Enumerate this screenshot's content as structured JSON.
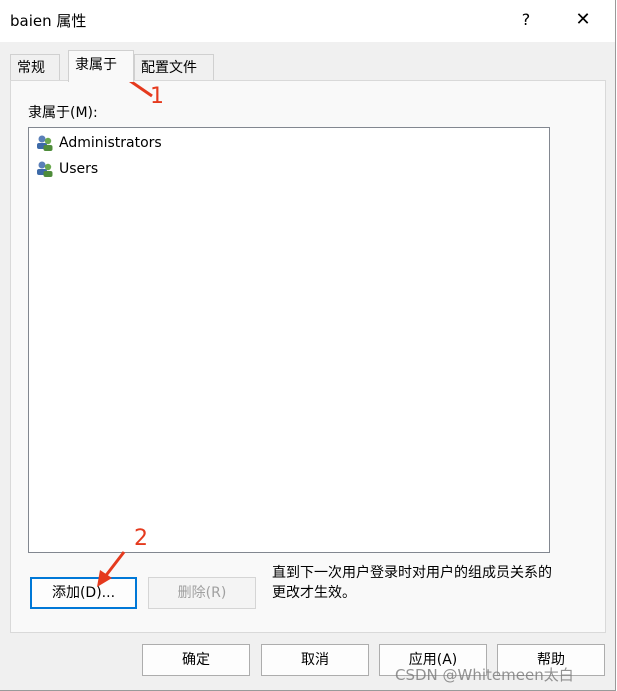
{
  "window": {
    "title": "baien 属性",
    "help_label": "?",
    "close_label": "✕"
  },
  "tabs": [
    {
      "label": "常规",
      "active": false
    },
    {
      "label": "隶属于",
      "active": true
    },
    {
      "label": "配置文件",
      "active": false
    }
  ],
  "member_of": {
    "label": "隶属于(M):",
    "items": [
      "Administrators",
      "Users"
    ]
  },
  "buttons": {
    "add": "添加(D)...",
    "remove": "删除(R)",
    "ok": "确定",
    "cancel": "取消",
    "apply": "应用(A)",
    "help": "帮助"
  },
  "note": "直到下一次用户登录时对用户的组成员关系的更改才生效。",
  "annotations": {
    "step1": "1",
    "step2": "2",
    "color": "#e53a1e"
  },
  "watermark": "CSDN @Whitemeen太白"
}
